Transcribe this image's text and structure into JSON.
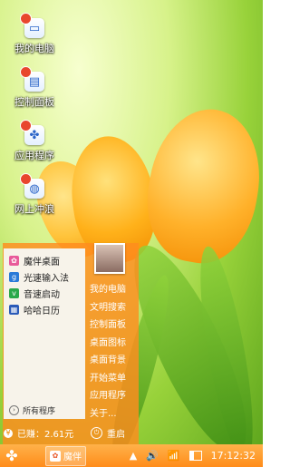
{
  "desktop": {
    "icons": [
      {
        "label": "我的电脑",
        "icon": "computer-icon"
      },
      {
        "label": "控制面板",
        "icon": "control-panel-icon"
      },
      {
        "label": "应用程序",
        "icon": "apps-icon"
      },
      {
        "label": "网上冲浪",
        "icon": "globe-icon"
      }
    ]
  },
  "start_menu": {
    "apps": [
      {
        "label": "魔伴桌面",
        "icon": "mobang-icon"
      },
      {
        "label": "光速输入法",
        "icon": "input-method-icon"
      },
      {
        "label": "音速启动",
        "icon": "launcher-icon"
      },
      {
        "label": "哈哈日历",
        "icon": "calendar-icon"
      }
    ],
    "all_programs": "所有程序",
    "right_items": [
      "我的电脑",
      "文明搜索",
      "控制面板",
      "桌面图标",
      "桌面背景",
      "开始菜单",
      "应用程序",
      "关于..."
    ],
    "earned": "已赚：2.61元",
    "restart": "重启"
  },
  "taskbar": {
    "task_label": "魔伴",
    "time": "17:12:32"
  },
  "colors": {
    "accent": "#ff8c1a"
  }
}
